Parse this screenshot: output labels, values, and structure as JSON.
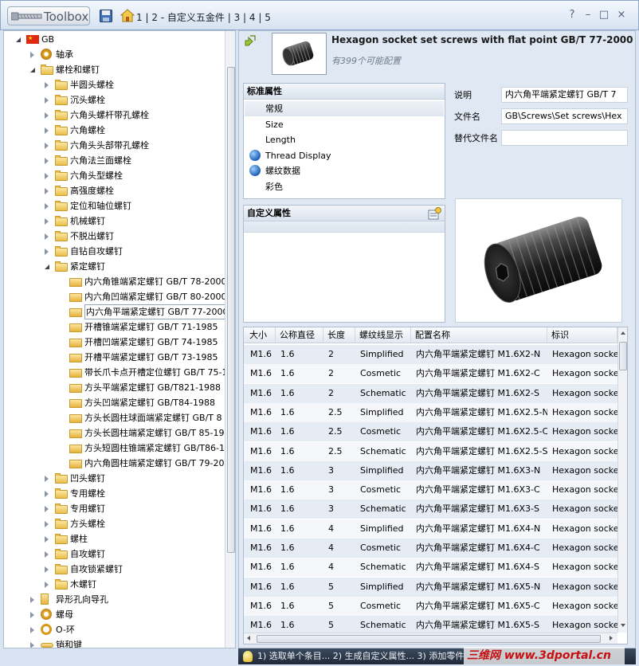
{
  "app": {
    "title": "Toolbox",
    "breadcrumb": [
      "1",
      "2 - 自定义五金件",
      "3",
      "4",
      "5"
    ]
  },
  "window_buttons": [
    "?",
    "–",
    "□",
    "×"
  ],
  "tree": [
    {
      "level": 0,
      "toggle": "open",
      "icon": "china-flag-icon",
      "label": "GB"
    },
    {
      "level": 1,
      "toggle": "closed",
      "icon": "bearing-icon",
      "label": "轴承"
    },
    {
      "level": 1,
      "toggle": "open",
      "icon": "bolt-folder-icon",
      "label": "螺栓和螺钉"
    },
    {
      "level": 2,
      "toggle": "closed",
      "icon": "folder-icon",
      "label": "半圆头螺栓"
    },
    {
      "level": 2,
      "toggle": "closed",
      "icon": "folder-icon",
      "label": "沉头螺栓"
    },
    {
      "level": 2,
      "toggle": "closed",
      "icon": "folder-icon",
      "label": "六角头螺杆带孔螺栓"
    },
    {
      "level": 2,
      "toggle": "closed",
      "icon": "folder-icon",
      "label": "六角螺栓"
    },
    {
      "level": 2,
      "toggle": "closed",
      "icon": "folder-icon",
      "label": "六角头头部带孔螺栓"
    },
    {
      "level": 2,
      "toggle": "closed",
      "icon": "folder-icon",
      "label": "六角法兰面螺栓"
    },
    {
      "level": 2,
      "toggle": "closed",
      "icon": "folder-icon",
      "label": "六角头型螺栓"
    },
    {
      "level": 2,
      "toggle": "closed",
      "icon": "folder-icon",
      "label": "高强度螺栓"
    },
    {
      "level": 2,
      "toggle": "closed",
      "icon": "folder-icon",
      "label": "定位和轴位螺钉"
    },
    {
      "level": 2,
      "toggle": "closed",
      "icon": "folder-icon",
      "label": "机械螺钉"
    },
    {
      "level": 2,
      "toggle": "closed",
      "icon": "folder-icon",
      "label": "不脱出螺钉"
    },
    {
      "level": 2,
      "toggle": "closed",
      "icon": "folder-icon",
      "label": "自钻自攻螺钉"
    },
    {
      "level": 2,
      "toggle": "open",
      "icon": "folder-icon",
      "label": "紧定螺钉"
    },
    {
      "level": 3,
      "toggle": "none",
      "icon": "part-icon",
      "label": "内六角锥端紧定螺钉 GB/T 78-2000"
    },
    {
      "level": 3,
      "toggle": "none",
      "icon": "part-icon",
      "label": "内六角凹端紧定螺钉 GB/T 80-2000"
    },
    {
      "level": 3,
      "toggle": "none",
      "icon": "part-icon",
      "label": "内六角平端紧定螺钉 GB/T 77-2000",
      "selected": true
    },
    {
      "level": 3,
      "toggle": "none",
      "icon": "part-icon",
      "label": "开槽锥端紧定螺钉 GB/T 71-1985"
    },
    {
      "level": 3,
      "toggle": "none",
      "icon": "part-icon",
      "label": "开槽凹端紧定螺钉 GB/T 74-1985"
    },
    {
      "level": 3,
      "toggle": "none",
      "icon": "part-icon",
      "label": "开槽平端紧定螺钉 GB/T 73-1985"
    },
    {
      "level": 3,
      "toggle": "none",
      "icon": "part-icon",
      "label": "带长爪卡点开槽定位螺钉 GB/T 75-1"
    },
    {
      "level": 3,
      "toggle": "none",
      "icon": "part-icon",
      "label": "方头平端紧定螺钉 GB/T821-1988"
    },
    {
      "level": 3,
      "toggle": "none",
      "icon": "part-icon",
      "label": "方头凹端紧定螺钉 GB/T84-1988"
    },
    {
      "level": 3,
      "toggle": "none",
      "icon": "part-icon",
      "label": "方头长圆柱球面端紧定螺钉 GB/T 8"
    },
    {
      "level": 3,
      "toggle": "none",
      "icon": "part-icon",
      "label": "方头长圆柱端紧定螺钉 GB/T 85-19"
    },
    {
      "level": 3,
      "toggle": "none",
      "icon": "part-icon",
      "label": "方头短圆柱锥端紧定螺钉 GB/T86-1"
    },
    {
      "level": 3,
      "toggle": "none",
      "icon": "part-icon",
      "label": "内六角圆柱端紧定螺钉 GB/T 79-20"
    },
    {
      "level": 2,
      "toggle": "closed",
      "icon": "folder-icon",
      "label": "凹头螺钉"
    },
    {
      "level": 2,
      "toggle": "closed",
      "icon": "folder-icon",
      "label": "专用螺栓"
    },
    {
      "level": 2,
      "toggle": "closed",
      "icon": "folder-icon",
      "label": "专用螺钉"
    },
    {
      "level": 2,
      "toggle": "closed",
      "icon": "folder-icon",
      "label": "方头螺栓"
    },
    {
      "level": 2,
      "toggle": "closed",
      "icon": "folder-icon",
      "label": "螺柱"
    },
    {
      "level": 2,
      "toggle": "closed",
      "icon": "folder-icon",
      "label": "自攻螺钉"
    },
    {
      "level": 2,
      "toggle": "closed",
      "icon": "folder-icon",
      "label": "自攻锁紧螺钉"
    },
    {
      "level": 2,
      "toggle": "closed",
      "icon": "folder-icon",
      "label": "木螺钉"
    },
    {
      "level": 1,
      "toggle": "closed",
      "icon": "hole-wizard-icon",
      "label": "异形孔向导孔"
    },
    {
      "level": 1,
      "toggle": "closed",
      "icon": "nut-icon",
      "label": "螺母"
    },
    {
      "level": 1,
      "toggle": "closed",
      "icon": "o-ring-icon",
      "label": "O-环"
    },
    {
      "level": 1,
      "toggle": "closed",
      "icon": "pin-key-icon",
      "label": "销和键"
    }
  ],
  "part": {
    "title": "Hexagon socket set screws with flat point GB/T 77-2000",
    "subtitle": "有399个可能配置"
  },
  "standard_props": {
    "header": "标准属性",
    "items": [
      {
        "label": "常规",
        "icon": "",
        "active": true
      },
      {
        "label": "Size",
        "icon": ""
      },
      {
        "label": "Length",
        "icon": ""
      },
      {
        "label": "Thread Display",
        "icon": "globe-icon"
      },
      {
        "label": "螺纹数据",
        "icon": "globe-icon"
      },
      {
        "label": "彩色",
        "icon": ""
      }
    ]
  },
  "custom_props": {
    "header": "自定义属性"
  },
  "fields": {
    "description_label": "说明",
    "description_value": "内六角平端紧定螺钉 GB/T 7",
    "filename_label": "文件名",
    "filename_value": "GB\\Screws\\Set screws\\Hex",
    "alt_filename_label": "替代文件名",
    "alt_filename_value": ""
  },
  "table": {
    "columns": [
      "大小",
      "公称直径",
      "长度",
      "螺纹线显示",
      "配置名称",
      "标识"
    ],
    "rows": [
      [
        "M1.6",
        "1.6",
        "2",
        "Simplified",
        "内六角平端紧定螺钉 M1.6X2-N",
        "Hexagon socket"
      ],
      [
        "M1.6",
        "1.6",
        "2",
        "Cosmetic",
        "内六角平端紧定螺钉 M1.6X2-C",
        "Hexagon socket"
      ],
      [
        "M1.6",
        "1.6",
        "2",
        "Schematic",
        "内六角平端紧定螺钉 M1.6X2-S",
        "Hexagon socket"
      ],
      [
        "M1.6",
        "1.6",
        "2.5",
        "Simplified",
        "内六角平端紧定螺钉 M1.6X2.5-N",
        "Hexagon socket"
      ],
      [
        "M1.6",
        "1.6",
        "2.5",
        "Cosmetic",
        "内六角平端紧定螺钉 M1.6X2.5-C",
        "Hexagon socket"
      ],
      [
        "M1.6",
        "1.6",
        "2.5",
        "Schematic",
        "内六角平端紧定螺钉 M1.6X2.5-S",
        "Hexagon socket"
      ],
      [
        "M1.6",
        "1.6",
        "3",
        "Simplified",
        "内六角平端紧定螺钉 M1.6X3-N",
        "Hexagon socket"
      ],
      [
        "M1.6",
        "1.6",
        "3",
        "Cosmetic",
        "内六角平端紧定螺钉 M1.6X3-C",
        "Hexagon socket"
      ],
      [
        "M1.6",
        "1.6",
        "3",
        "Schematic",
        "内六角平端紧定螺钉 M1.6X3-S",
        "Hexagon socket"
      ],
      [
        "M1.6",
        "1.6",
        "4",
        "Simplified",
        "内六角平端紧定螺钉 M1.6X4-N",
        "Hexagon socket"
      ],
      [
        "M1.6",
        "1.6",
        "4",
        "Cosmetic",
        "内六角平端紧定螺钉 M1.6X4-C",
        "Hexagon socket"
      ],
      [
        "M1.6",
        "1.6",
        "4",
        "Schematic",
        "内六角平端紧定螺钉 M1.6X4-S",
        "Hexagon socket"
      ],
      [
        "M1.6",
        "1.6",
        "5",
        "Simplified",
        "内六角平端紧定螺钉 M1.6X5-N",
        "Hexagon socket"
      ],
      [
        "M1.6",
        "1.6",
        "5",
        "Cosmetic",
        "内六角平端紧定螺钉 M1.6X5-C",
        "Hexagon socket"
      ],
      [
        "M1.6",
        "1.6",
        "5",
        "Schematic",
        "内六角平端紧定螺钉 M1.6X5-S",
        "Hexagon socket"
      ]
    ]
  },
  "status": {
    "text": "1) 选取单个条目... 2) 生成自定义属性... 3) 添加零件"
  },
  "watermark": "三维网 www.3dportal.cn"
}
